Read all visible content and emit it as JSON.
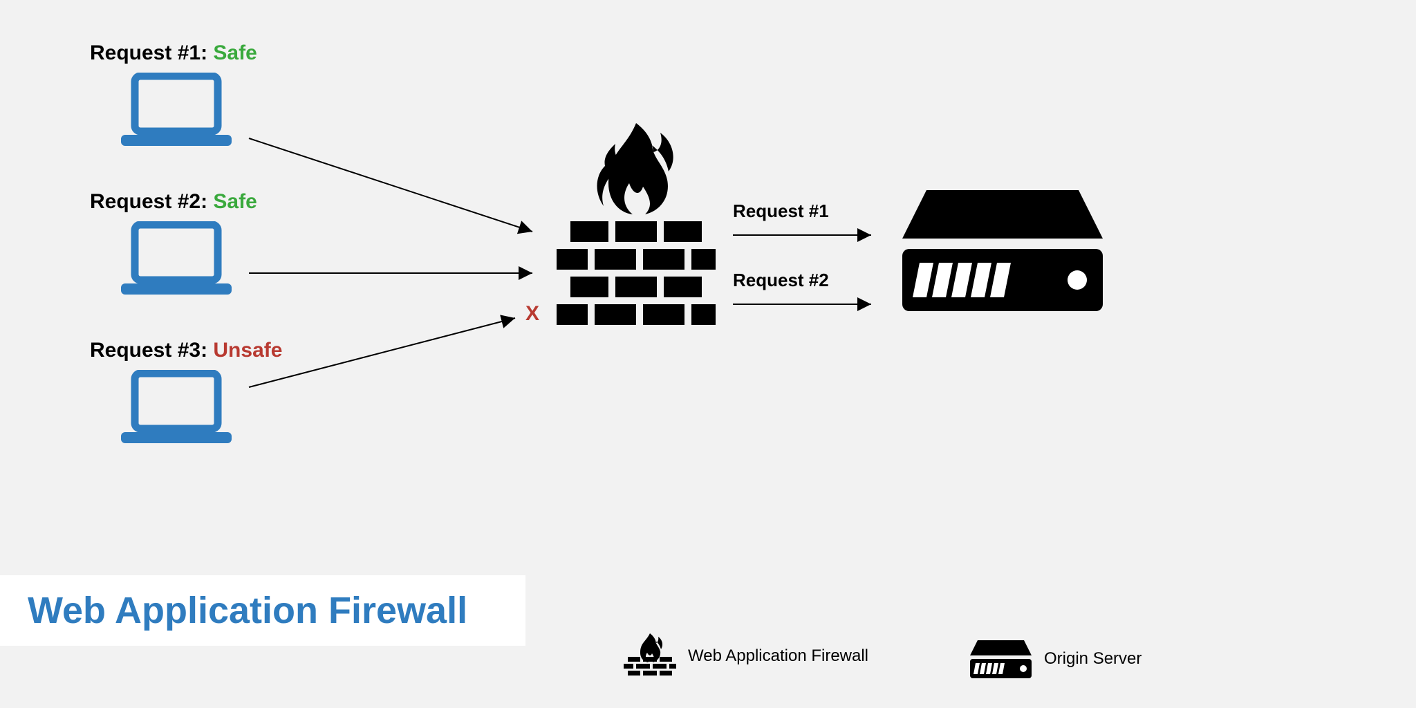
{
  "title": "Web Application Firewall",
  "requests": [
    {
      "prefix": "Request #1: ",
      "status": "Safe",
      "status_class": "safe"
    },
    {
      "prefix": "Request #2: ",
      "status": "Safe",
      "status_class": "safe"
    },
    {
      "prefix": "Request #3: ",
      "status": "Unsafe",
      "status_class": "unsafe"
    }
  ],
  "blocked_marker": "X",
  "passed": [
    {
      "label": "Request #1"
    },
    {
      "label": "Request #2"
    }
  ],
  "legend": {
    "waf": "Web Application Firewall",
    "server": "Origin Server"
  },
  "colors": {
    "laptop": "#2f7cbf",
    "safe": "#3aa93d",
    "unsafe": "#b83a31",
    "title": "#2f7cbf"
  }
}
